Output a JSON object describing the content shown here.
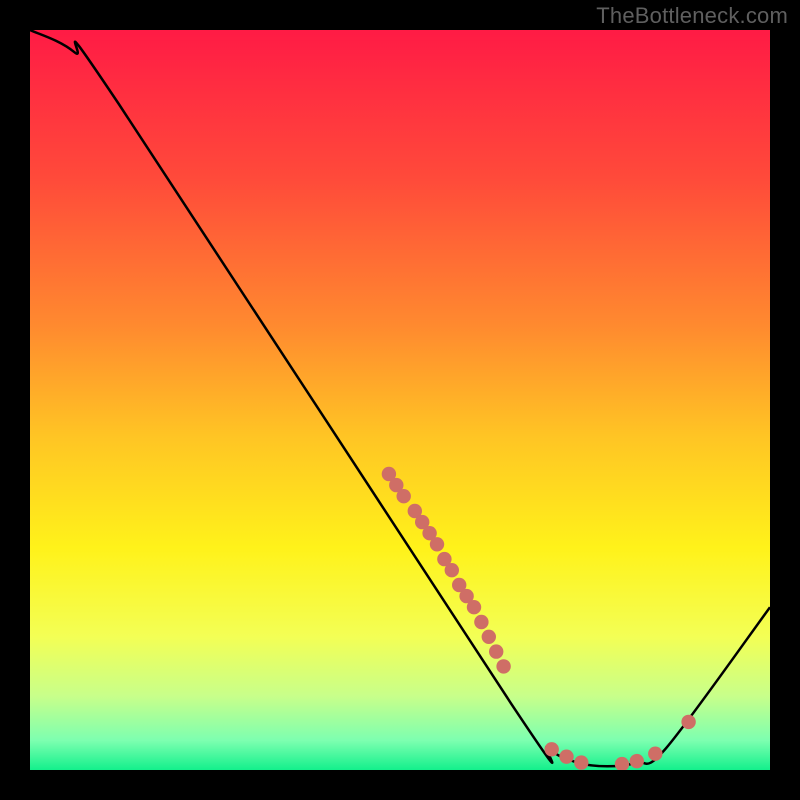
{
  "watermark": "TheBottleneck.com",
  "chart_data": {
    "type": "line",
    "title": "",
    "xlabel": "",
    "ylabel": "",
    "xlim": [
      0,
      100
    ],
    "ylim": [
      0,
      100
    ],
    "curve": {
      "name": "bottleneck-curve",
      "points": [
        {
          "x": 0,
          "y": 100
        },
        {
          "x": 6,
          "y": 97
        },
        {
          "x": 12,
          "y": 90
        },
        {
          "x": 65,
          "y": 9
        },
        {
          "x": 70,
          "y": 3
        },
        {
          "x": 74,
          "y": 1
        },
        {
          "x": 78,
          "y": 0.5
        },
        {
          "x": 82,
          "y": 1
        },
        {
          "x": 86,
          "y": 3
        },
        {
          "x": 100,
          "y": 22
        }
      ]
    },
    "scatter": {
      "name": "marker-points",
      "points": [
        {
          "x": 48.5,
          "y": 40.0
        },
        {
          "x": 49.5,
          "y": 38.5
        },
        {
          "x": 50.5,
          "y": 37.0
        },
        {
          "x": 52.0,
          "y": 35.0
        },
        {
          "x": 53.0,
          "y": 33.5
        },
        {
          "x": 54.0,
          "y": 32.0
        },
        {
          "x": 55.0,
          "y": 30.5
        },
        {
          "x": 56.0,
          "y": 28.5
        },
        {
          "x": 57.0,
          "y": 27.0
        },
        {
          "x": 58.0,
          "y": 25.0
        },
        {
          "x": 59.0,
          "y": 23.5
        },
        {
          "x": 60.0,
          "y": 22.0
        },
        {
          "x": 61.0,
          "y": 20.0
        },
        {
          "x": 62.0,
          "y": 18.0
        },
        {
          "x": 63.0,
          "y": 16.0
        },
        {
          "x": 64.0,
          "y": 14.0
        },
        {
          "x": 70.5,
          "y": 2.8
        },
        {
          "x": 72.5,
          "y": 1.8
        },
        {
          "x": 74.5,
          "y": 1.0
        },
        {
          "x": 80.0,
          "y": 0.8
        },
        {
          "x": 82.0,
          "y": 1.2
        },
        {
          "x": 84.5,
          "y": 2.2
        },
        {
          "x": 89.0,
          "y": 6.5
        }
      ]
    },
    "gradient_stops": [
      {
        "offset": 0.0,
        "color": "#ff1b45"
      },
      {
        "offset": 0.2,
        "color": "#ff4a3a"
      },
      {
        "offset": 0.4,
        "color": "#ff8a2f"
      },
      {
        "offset": 0.55,
        "color": "#ffc524"
      },
      {
        "offset": 0.7,
        "color": "#fff21a"
      },
      {
        "offset": 0.82,
        "color": "#f3ff55"
      },
      {
        "offset": 0.9,
        "color": "#c8ff8a"
      },
      {
        "offset": 0.96,
        "color": "#7dffb0"
      },
      {
        "offset": 1.0,
        "color": "#13f08c"
      }
    ],
    "marker_color": "#cf6e66",
    "curve_color": "#000000"
  }
}
